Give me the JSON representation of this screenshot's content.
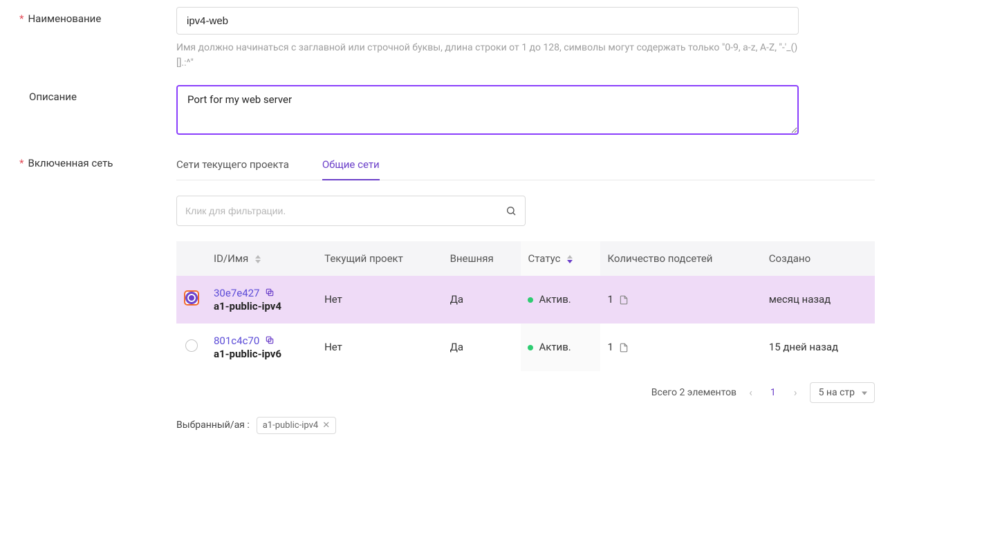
{
  "fields": {
    "name_label": "Наименование",
    "name_value": "ipv4-web",
    "name_hint": "Имя должно начинаться с заглавной или строчной буквы, длина строки от 1 до 128, символы могут содержать только \"0-9, a-z, A-Z, \"-'_()[].:^\"",
    "desc_label": "Описание",
    "desc_value": "Port for my web server",
    "network_label": "Включенная сеть"
  },
  "tabs": {
    "current": "Сети текущего проекта",
    "shared": "Общие сети"
  },
  "filter": {
    "placeholder": "Клик для фильтрации."
  },
  "table": {
    "headers": {
      "id": "ID/Имя",
      "project": "Текущий проект",
      "external": "Внешняя",
      "status": "Статус",
      "subnets": "Количество подсетей",
      "created": "Создано"
    },
    "rows": [
      {
        "id": "30e7e427",
        "name": "a1-public-ipv4",
        "project": "Нет",
        "external": "Да",
        "status": "Актив.",
        "subnets": "1",
        "created": "месяц назад",
        "selected": true
      },
      {
        "id": "801c4c70",
        "name": "a1-public-ipv6",
        "project": "Нет",
        "external": "Да",
        "status": "Актив.",
        "subnets": "1",
        "created": "15 дней назад",
        "selected": false
      }
    ]
  },
  "pagination": {
    "total_text": "Всего 2 элементов",
    "page": "1",
    "page_size": "5 на стр"
  },
  "selected": {
    "label": "Выбранный/ая :",
    "value": "a1-public-ipv4"
  }
}
